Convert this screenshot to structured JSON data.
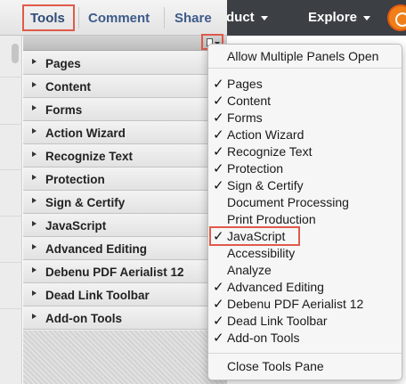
{
  "site_nav": {
    "product_label": "duct",
    "explore_label": "Explore"
  },
  "tabs": [
    {
      "label": "Tools"
    },
    {
      "label": "Comment"
    },
    {
      "label": "Share"
    }
  ],
  "tools_pane": {
    "panels": [
      {
        "label": "Pages"
      },
      {
        "label": "Content"
      },
      {
        "label": "Forms"
      },
      {
        "label": "Action Wizard"
      },
      {
        "label": "Recognize Text"
      },
      {
        "label": "Protection"
      },
      {
        "label": "Sign & Certify"
      },
      {
        "label": "JavaScript"
      },
      {
        "label": "Advanced Editing"
      },
      {
        "label": "Debenu PDF Aerialist 12"
      },
      {
        "label": "Dead Link Toolbar"
      },
      {
        "label": "Add-on Tools"
      }
    ]
  },
  "menu": {
    "top_item": "Allow Multiple Panels Open",
    "items": [
      {
        "label": "Pages",
        "checked": true,
        "check": "✓"
      },
      {
        "label": "Content",
        "checked": true,
        "check": "✓"
      },
      {
        "label": "Forms",
        "checked": true,
        "check": "✓"
      },
      {
        "label": "Action Wizard",
        "checked": true,
        "check": "✓"
      },
      {
        "label": "Recognize Text",
        "checked": true,
        "check": "✓"
      },
      {
        "label": "Protection",
        "checked": true,
        "check": "✓"
      },
      {
        "label": "Sign & Certify",
        "checked": true,
        "check": "✓"
      },
      {
        "label": "Document Processing",
        "checked": false,
        "check": ""
      },
      {
        "label": "Print Production",
        "checked": false,
        "check": ""
      },
      {
        "label": "JavaScript",
        "checked": true,
        "check": "✓"
      },
      {
        "label": "Accessibility",
        "checked": false,
        "check": ""
      },
      {
        "label": "Analyze",
        "checked": false,
        "check": ""
      },
      {
        "label": "Advanced Editing",
        "checked": true,
        "check": "✓"
      },
      {
        "label": "Debenu PDF Aerialist 12",
        "checked": true,
        "check": "✓"
      },
      {
        "label": "Dead Link Toolbar",
        "checked": true,
        "check": "✓"
      },
      {
        "label": "Add-on Tools",
        "checked": true,
        "check": "✓"
      }
    ],
    "bottom_item": "Close Tools Pane"
  },
  "colors": {
    "highlight": "#e05a4a",
    "tab_text": "#3d5a8a",
    "site_nav_bg": "#3c3f44",
    "avatar": "#f07f1a"
  },
  "icons": {
    "panel_options": "panel-options-icon",
    "avatar": "user-avatar-icon"
  }
}
